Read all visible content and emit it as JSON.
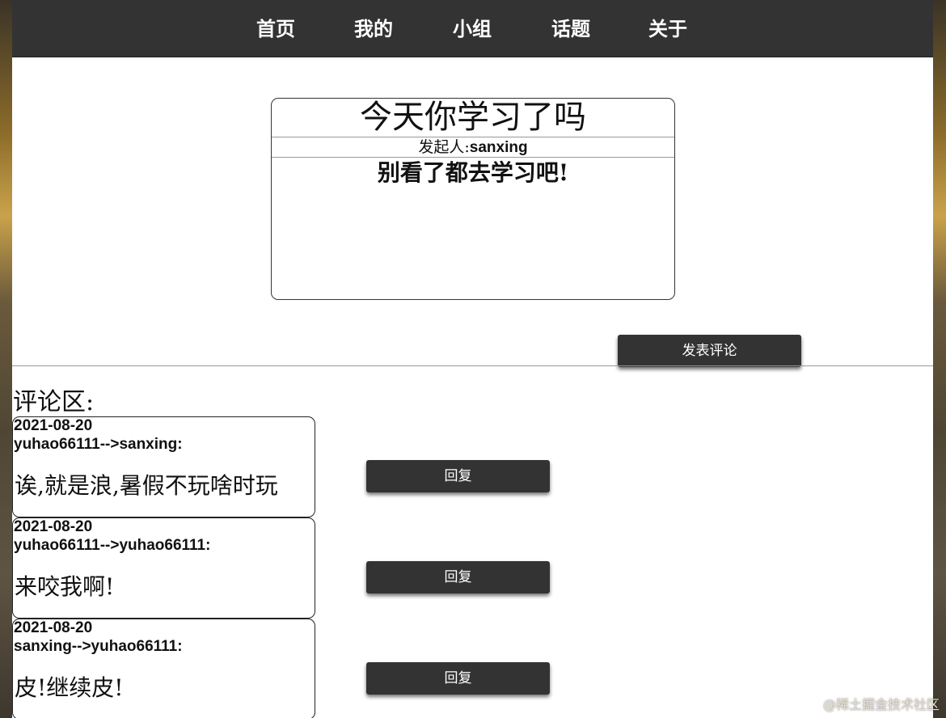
{
  "nav": {
    "items": [
      {
        "label": "首页"
      },
      {
        "label": "我的"
      },
      {
        "label": "小组"
      },
      {
        "label": "话题"
      },
      {
        "label": "关于"
      }
    ]
  },
  "topic": {
    "title": "今天你学习了吗",
    "author_prefix": "发起人:",
    "author_name": "sanxing",
    "body": "别看了都去学习吧!"
  },
  "actions": {
    "post_comment_label": "发表评论"
  },
  "comments_section": {
    "heading": "评论区:",
    "reply_label": "回复",
    "items": [
      {
        "date": "2021-08-20",
        "users": "yuhao66111-->sanxing:",
        "text": "诶,就是浪,暑假不玩啥时玩"
      },
      {
        "date": "2021-08-20",
        "users": "yuhao66111-->yuhao66111:",
        "text": "来咬我啊!"
      },
      {
        "date": "2021-08-20",
        "users": "sanxing-->yuhao66111:",
        "text": "皮!继续皮!"
      }
    ]
  },
  "watermark": "@稀土掘金技术社区",
  "colors": {
    "navbar": "#333333",
    "button": "#333333",
    "page": "#ffffff"
  }
}
